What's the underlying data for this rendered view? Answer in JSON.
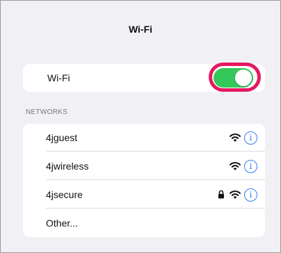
{
  "nav": {
    "title": "Wi-Fi"
  },
  "wifi_toggle": {
    "label": "Wi-Fi",
    "on": true,
    "color": "#34c759",
    "highlight_color": "#e6195e"
  },
  "networks": {
    "header": "NETWORKS",
    "items": [
      {
        "name": "4jguest",
        "secured": false,
        "signal_icon": "wifi-icon",
        "info_icon": "info-icon",
        "info_glyph": "i"
      },
      {
        "name": "4jwireless",
        "secured": false,
        "signal_icon": "wifi-icon",
        "info_icon": "info-icon",
        "info_glyph": "i"
      },
      {
        "name": "4jsecure",
        "secured": true,
        "signal_icon": "wifi-icon",
        "lock_icon": "lock-icon",
        "info_icon": "info-icon",
        "info_glyph": "i"
      }
    ],
    "other_label": "Other..."
  },
  "accent_color": "#2f7cf6"
}
